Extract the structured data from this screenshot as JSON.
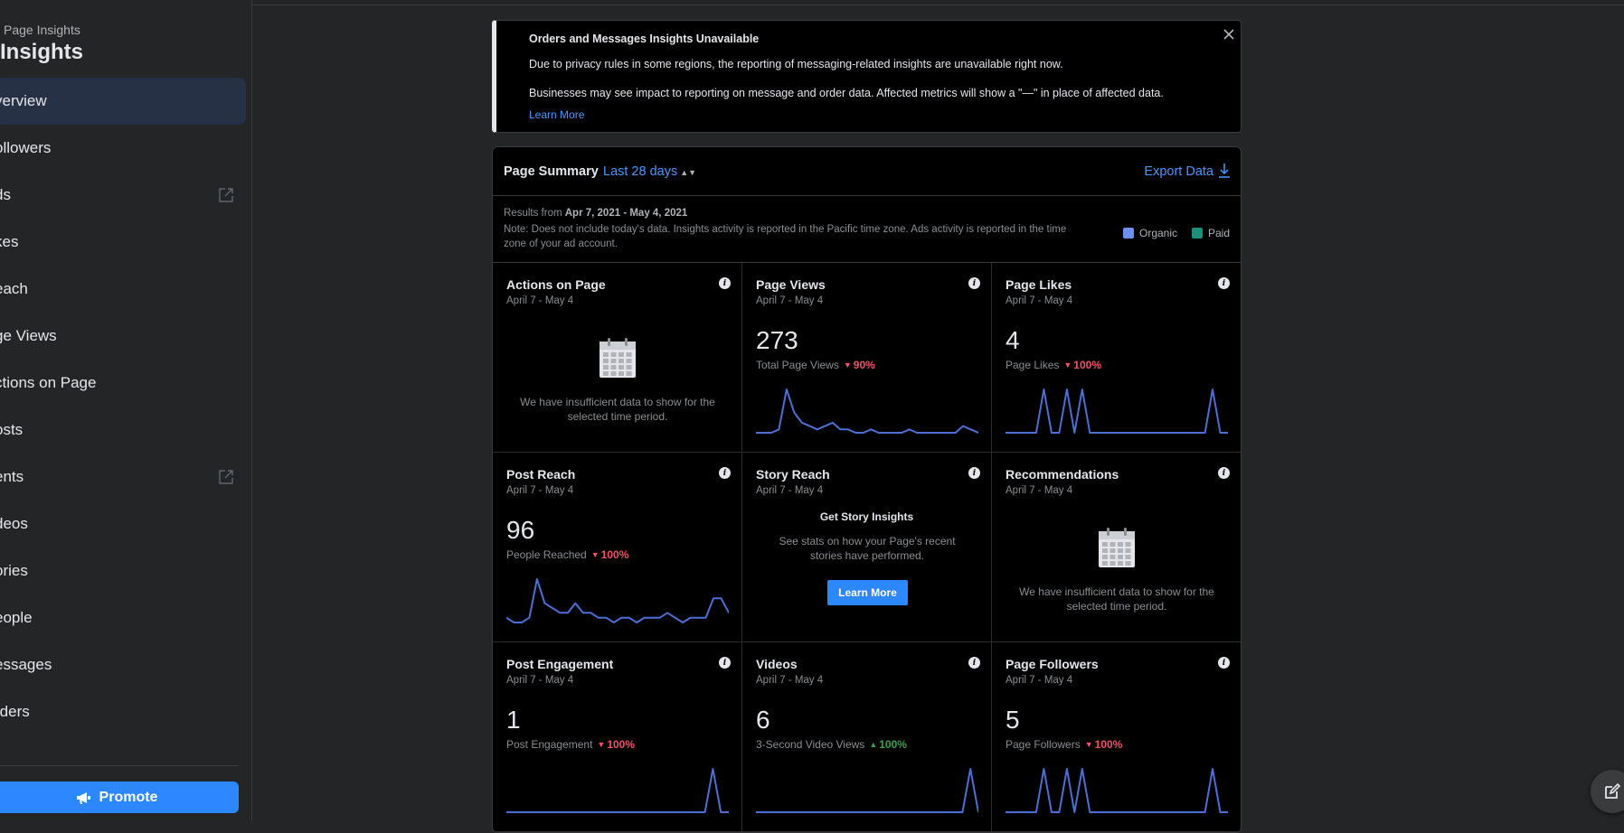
{
  "sidebar": {
    "breadcrumb": "Page Insights",
    "title": "Insights",
    "items": [
      {
        "label": "verview",
        "active": true,
        "external": false
      },
      {
        "label": "ollowers",
        "active": false,
        "external": false
      },
      {
        "label": "ds",
        "active": false,
        "external": true
      },
      {
        "label": "kes",
        "active": false,
        "external": false
      },
      {
        "label": "each",
        "active": false,
        "external": false
      },
      {
        "label": "ge Views",
        "active": false,
        "external": false
      },
      {
        "label": "ctions on Page",
        "active": false,
        "external": false
      },
      {
        "label": "osts",
        "active": false,
        "external": false
      },
      {
        "label": "ents",
        "active": false,
        "external": true
      },
      {
        "label": "deos",
        "active": false,
        "external": false
      },
      {
        "label": "ories",
        "active": false,
        "external": false
      },
      {
        "label": "eople",
        "active": false,
        "external": false
      },
      {
        "label": "essages",
        "active": false,
        "external": false
      },
      {
        "label": "rders",
        "active": false,
        "external": false
      }
    ],
    "promote_label": "Promote"
  },
  "banner": {
    "title": "Orders and Messages Insights Unavailable",
    "line1": "Due to privacy rules in some regions, the reporting of messaging-related insights are unavailable right now.",
    "line2": "Businesses may see impact to reporting on message and order data. Affected metrics will show a \"—\" in place of affected data.",
    "link": "Learn More"
  },
  "summary": {
    "title": "Page Summary",
    "range": "Last 28 days",
    "export": "Export Data",
    "results_prefix": "Results from",
    "results_dates": "Apr 7, 2021 - May 4, 2021",
    "note": "Note: Does not include today's data. Insights activity is reported in the Pacific time zone. Ads activity is reported in the time zone of your ad account.",
    "legend": [
      {
        "label": "Organic",
        "color": "#6e91f0"
      },
      {
        "label": "Paid",
        "color": "#1d8f7a"
      }
    ]
  },
  "colors": {
    "accent": "#2d88ff",
    "link": "#4599ff",
    "spark": "#4c6fd6",
    "down": "#f25268",
    "up": "#35a34b"
  },
  "cards": [
    {
      "title": "Actions on Page",
      "date": "April 7 - May 4",
      "kind": "empty",
      "message": "We have insufficient data to show for the selected time period."
    },
    {
      "title": "Page Views",
      "date": "April 7 - May 4",
      "kind": "metric",
      "value": "273",
      "sublabel": "Total Page Views",
      "change": "90%",
      "direction": "down",
      "series": [
        0,
        0,
        0,
        1,
        13,
        6,
        3,
        2,
        1,
        2,
        3,
        1,
        1,
        0,
        0,
        1,
        0,
        0,
        0,
        0,
        1,
        0,
        0,
        0,
        0,
        0,
        0,
        2,
        1,
        0
      ]
    },
    {
      "title": "Page Likes",
      "date": "April 7 - May 4",
      "kind": "metric",
      "value": "4",
      "sublabel": "Page Likes",
      "change": "100%",
      "direction": "down",
      "series": [
        0,
        0,
        0,
        0,
        0,
        1,
        0,
        0,
        1,
        0,
        1,
        0,
        0,
        0,
        0,
        0,
        0,
        0,
        0,
        0,
        0,
        0,
        0,
        0,
        0,
        0,
        0,
        1,
        0,
        0
      ]
    },
    {
      "title": "Post Reach",
      "date": "April 7 - May 4",
      "kind": "metric",
      "value": "96",
      "sublabel": "People Reached",
      "change": "100%",
      "direction": "down",
      "series": [
        1,
        0,
        0,
        1,
        9,
        4,
        3,
        2,
        2,
        4,
        2,
        2,
        1,
        1,
        0,
        1,
        1,
        0,
        1,
        1,
        1,
        2,
        1,
        0,
        1,
        1,
        1,
        5,
        5,
        2
      ]
    },
    {
      "title": "Story Reach",
      "date": "April 7 - May 4",
      "kind": "story",
      "heading": "Get Story Insights",
      "message": "See stats on how your Page's recent stories have performed.",
      "button": "Learn More"
    },
    {
      "title": "Recommendations",
      "date": "April 7 - May 4",
      "kind": "empty",
      "message": "We have insufficient data to show for the selected time period."
    },
    {
      "title": "Post Engagement",
      "date": "April 7 - May 4",
      "kind": "metric",
      "value": "1",
      "sublabel": "Post Engagement",
      "change": "100%",
      "direction": "down",
      "series": [
        0,
        0,
        0,
        0,
        0,
        0,
        0,
        0,
        0,
        0,
        0,
        0,
        0,
        0,
        0,
        0,
        0,
        0,
        0,
        0,
        0,
        0,
        0,
        0,
        0,
        0,
        1,
        0,
        0
      ]
    },
    {
      "title": "Videos",
      "date": "April 7 - May 4",
      "kind": "metric",
      "value": "6",
      "sublabel": "3-Second Video Views",
      "change": "100%",
      "direction": "up",
      "series": [
        0,
        0,
        0,
        0,
        0,
        0,
        0,
        0,
        0,
        0,
        0,
        0,
        0,
        0,
        0,
        0,
        0,
        0,
        0,
        0,
        0,
        0,
        0,
        0,
        0,
        0,
        0,
        1,
        0
      ]
    },
    {
      "title": "Page Followers",
      "date": "April 7 - May 4",
      "kind": "metric",
      "value": "5",
      "sublabel": "Page Followers",
      "change": "100%",
      "direction": "down",
      "series": [
        0,
        0,
        0,
        0,
        0,
        1,
        0,
        0,
        1,
        0,
        1,
        0,
        0,
        0,
        0,
        0,
        0,
        0,
        0,
        0,
        0,
        0,
        0,
        0,
        0,
        0,
        0,
        1,
        0,
        0
      ]
    }
  ]
}
